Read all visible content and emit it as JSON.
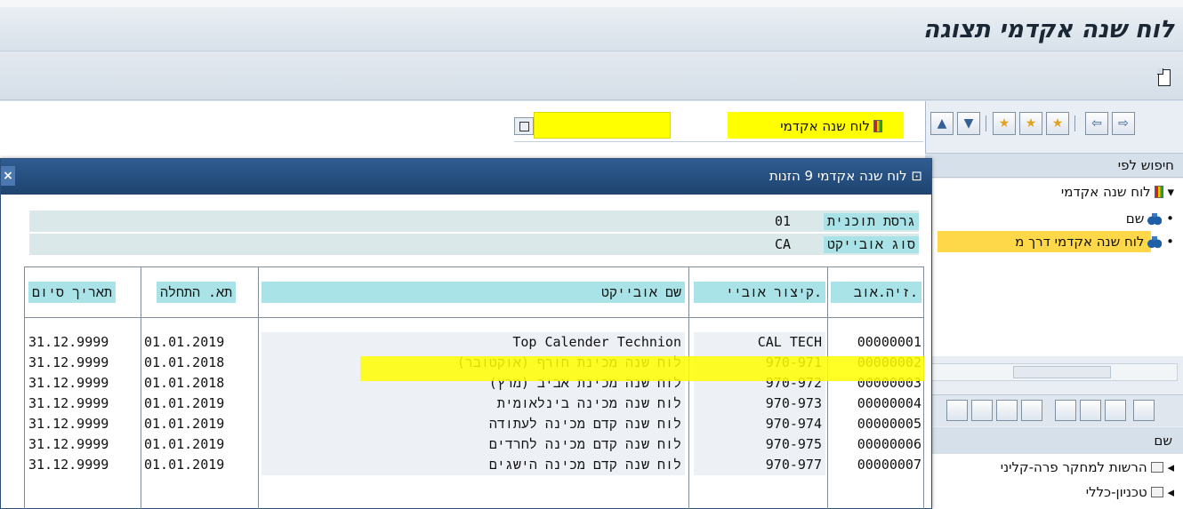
{
  "window": {
    "title": "לוח שנה אקדמי תצוגה"
  },
  "header_area": {
    "calendar_label": "לוח שנה אקדמי",
    "field_value": ""
  },
  "nav": {
    "search_by": "חיפוש לפי",
    "tree": [
      {
        "label": "לוח שנה אקדמי",
        "icon": "calendar-icon"
      },
      {
        "label": "שם",
        "icon": "binoculars-icon"
      },
      {
        "label": "לוח שנה אקדמי דרך מ",
        "icon": "binoculars-icon"
      }
    ],
    "list_header": "שם",
    "list_items": [
      "הרשות למחקר פרה-קליני",
      "טכניון-כללי"
    ]
  },
  "dialog": {
    "title": "לוח שנה אקדמי 9 הזנות",
    "plan_version_label": "גרסת תוכנית",
    "plan_version_value": "01",
    "object_type_label": "סוג אובייקט",
    "object_type_value": "CA",
    "columns": {
      "id": "זיה.אוב.",
      "abbr": "קיצור אוביי.",
      "name": "שם אובייקט",
      "start": "תא. התחלה",
      "end": "תאריך סיום"
    },
    "rows": [
      {
        "id": "00000001",
        "abbr": "CAL TECH",
        "name": "Top Calender Technion",
        "start": "01.01.2019",
        "end": "31.12.9999"
      },
      {
        "id": "00000002",
        "abbr": "970-971",
        "name": "לוח שנה מכינת חורף (אוקטובר)",
        "start": "01.01.2018",
        "end": "31.12.9999"
      },
      {
        "id": "00000003",
        "abbr": "970-972",
        "name": "לוח שנה מכינת אביב (מרץ)",
        "start": "01.01.2018",
        "end": "31.12.9999"
      },
      {
        "id": "00000004",
        "abbr": "970-973",
        "name": "לוח שנה מכינה בינלאומית",
        "start": "01.01.2019",
        "end": "31.12.9999"
      },
      {
        "id": "00000005",
        "abbr": "970-974",
        "name": "לוח שנה קדם מכינה לעתודה",
        "start": "01.01.2019",
        "end": "31.12.9999"
      },
      {
        "id": "00000006",
        "abbr": "970-975",
        "name": "לוח שנה קדם מכינה לחרדים",
        "start": "01.01.2019",
        "end": "31.12.9999"
      },
      {
        "id": "00000007",
        "abbr": "970-977",
        "name": "לוח שנה קדם מכינה הישגים",
        "start": "01.01.2019",
        "end": "31.12.9999"
      }
    ]
  }
}
